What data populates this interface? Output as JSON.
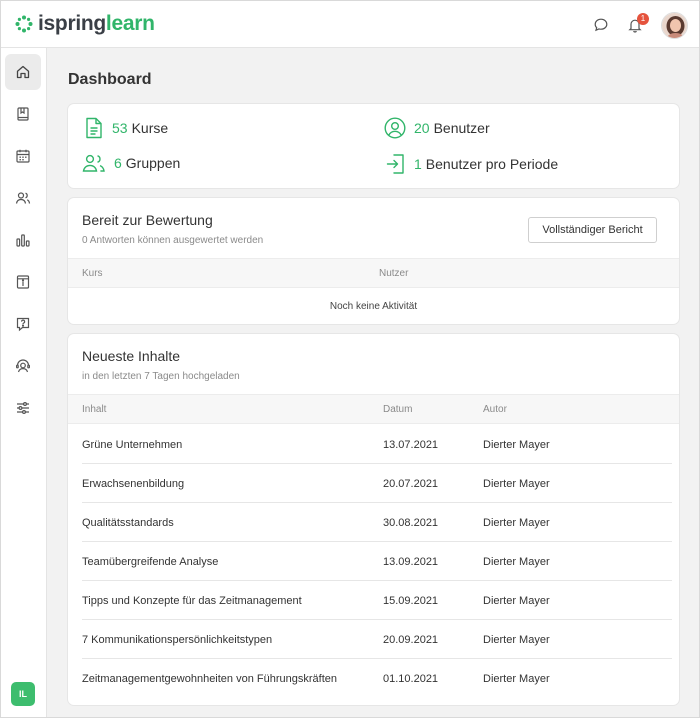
{
  "header": {
    "logo_part1": "ispring",
    "logo_part2": "learn",
    "notification_count": "1",
    "avatar_colors": {
      "bg": "#c98b7a",
      "hair": "#5a3a30"
    }
  },
  "colors": {
    "accent": "#31b56a",
    "badge": "#e5533d"
  },
  "sidebar": {
    "items": [
      {
        "icon": "home-icon"
      },
      {
        "icon": "book-icon"
      },
      {
        "icon": "calendar-icon"
      },
      {
        "icon": "users-icon"
      },
      {
        "icon": "bar-chart-icon"
      },
      {
        "icon": "info-icon"
      },
      {
        "icon": "question-icon"
      },
      {
        "icon": "user-support-icon"
      },
      {
        "icon": "settings-sliders-icon"
      }
    ],
    "user_initials": "IL"
  },
  "page_title": "Dashboard",
  "stats": {
    "courses_num": "53",
    "courses_label": "Kurse",
    "users_num": "20",
    "users_label": "Benutzer",
    "groups_num": "6",
    "groups_label": "Gruppen",
    "period_num": "1",
    "period_label": "Benutzer pro Periode"
  },
  "grading": {
    "title": "Bereit zur Bewertung",
    "subtitle": "0 Antworten können ausgewertet werden",
    "button": "Vollständiger Bericht",
    "col_course": "Kurs",
    "col_user": "Nutzer",
    "empty": "Noch keine Aktivität"
  },
  "latest": {
    "title": "Neueste Inhalte",
    "subtitle": "in den letzten 7 Tagen hochgeladen",
    "col_content": "Inhalt",
    "col_date": "Datum",
    "col_author": "Autor",
    "rows": [
      {
        "content": "Grüne Unternehmen",
        "date": "13.07.2021",
        "author": "Dierter Mayer"
      },
      {
        "content": "Erwachsenenbildung",
        "date": "20.07.2021",
        "author": "Dierter Mayer"
      },
      {
        "content": "Qualitätsstandards",
        "date": "30.08.2021",
        "author": "Dierter Mayer"
      },
      {
        "content": "Teamübergreifende Analyse",
        "date": "13.09.2021",
        "author": "Dierter Mayer"
      },
      {
        "content": "Tipps und Konzepte für das Zeitmanagement",
        "date": "15.09.2021",
        "author": "Dierter Mayer"
      },
      {
        "content": "7 Kommunikationspersönlichkeitstypen",
        "date": "20.09.2021",
        "author": "Dierter Mayer"
      },
      {
        "content": "Zeitmanagementgewohnheiten von Führungskräften",
        "date": "01.10.2021",
        "author": "Dierter Mayer"
      }
    ]
  }
}
